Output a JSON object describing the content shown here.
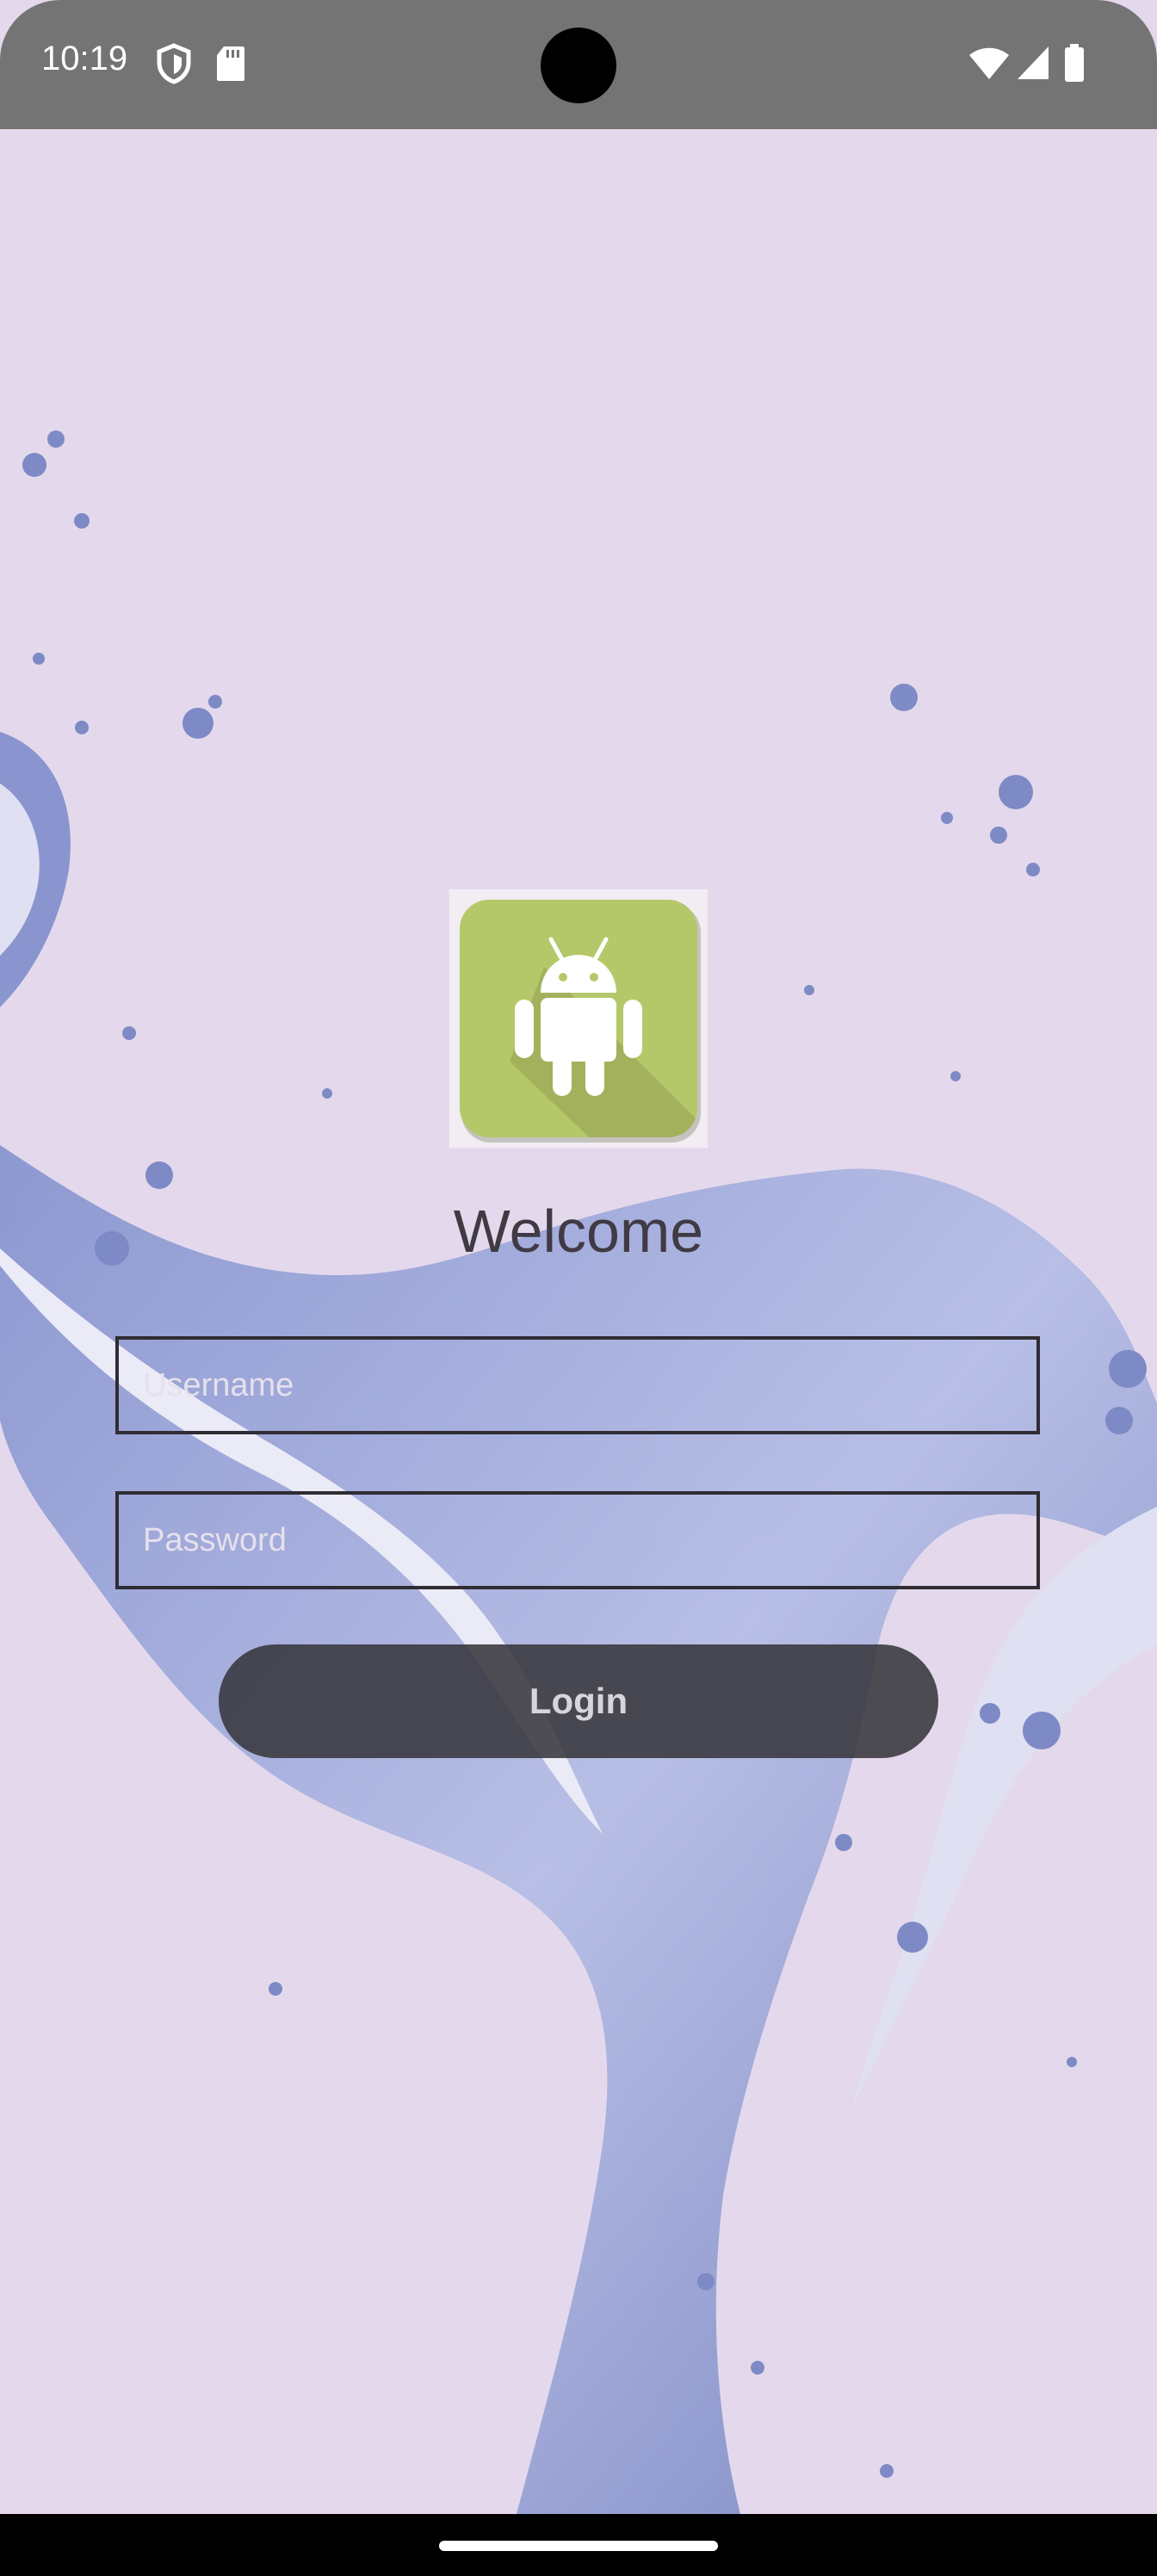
{
  "status_bar": {
    "time": "10:19",
    "left_icons": [
      "shield-icon",
      "sd-card-icon"
    ],
    "right_icons": [
      "wifi-icon",
      "cellular-signal-icon",
      "battery-icon"
    ],
    "background": "#747474"
  },
  "login": {
    "logo": "android-app-icon",
    "welcome_text": "Welcome",
    "username_placeholder": "Username",
    "username_value": "",
    "password_placeholder": "Password",
    "password_value": "",
    "login_button_label": "Login"
  },
  "colors": {
    "background": "#e4d9ec",
    "logo_green": "#b4c86a",
    "splash_blue": "#5a6fb8",
    "button": "#37373c"
  }
}
